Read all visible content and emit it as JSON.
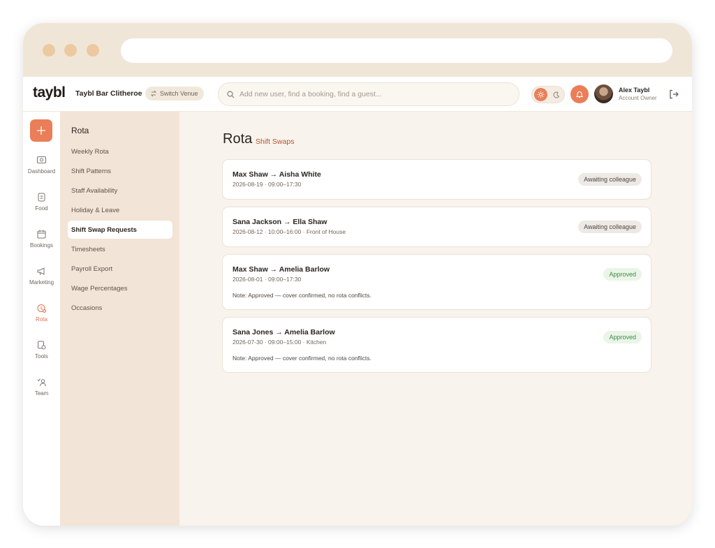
{
  "colors": {
    "accent": "#ea7e58",
    "accent_text": "#b5532f",
    "titlebar": "#f0e6d8",
    "subnav_bg": "#f2e4d6",
    "main_bg": "#f8f3ec",
    "awaiting_badge_bg": "#ede9e4",
    "approved_badge_bg": "#eaf5e8",
    "approved_badge_text": "#3d8a45"
  },
  "header": {
    "logo": "taybl",
    "venue": "Taybl Bar Clitheroe",
    "switch_venue": "Switch Venue",
    "search_placeholder": "Add new user, find a booking, find a guest...",
    "user_name": "Alex Taybl",
    "user_role": "Account Owner",
    "icons": [
      "sun-icon",
      "moon-icon",
      "bell-icon",
      "avatar",
      "logout-icon"
    ]
  },
  "rail": {
    "items": [
      {
        "label": "Dashboard",
        "icon": "dashboard-icon",
        "active": false
      },
      {
        "label": "Food",
        "icon": "food-icon",
        "active": false
      },
      {
        "label": "Bookings",
        "icon": "bookings-icon",
        "active": false
      },
      {
        "label": "Marketing",
        "icon": "megaphone-icon",
        "active": false
      },
      {
        "label": "Rota",
        "icon": "rota-icon",
        "active": true
      },
      {
        "label": "Tools",
        "icon": "tools-icon",
        "active": false
      },
      {
        "label": "Team",
        "icon": "team-icon",
        "active": false
      }
    ]
  },
  "subnav": {
    "title": "Rota",
    "items": [
      {
        "label": "Weekly Rota"
      },
      {
        "label": "Shift Patterns"
      },
      {
        "label": "Staff Availability"
      },
      {
        "label": "Holiday & Leave"
      },
      {
        "label": "Shift Swap Requests",
        "active": true
      },
      {
        "label": "Timesheets"
      },
      {
        "label": "Payroll Export"
      },
      {
        "label": "Wage Percentages"
      },
      {
        "label": "Occasions"
      }
    ]
  },
  "main": {
    "title": "Rota",
    "subtitle": "Shift Swaps",
    "swaps": [
      {
        "title": "Max Shaw → Aisha White",
        "meta": "2026-08-19 · 09:00–17:30",
        "status": "Awaiting colleague",
        "note": ""
      },
      {
        "title": "Sana Jackson → Ella Shaw",
        "meta": "2026-08-12 · 10:00–16:00 · Front of House",
        "status": "Awaiting colleague",
        "note": ""
      },
      {
        "title": "Max Shaw → Amelia Barlow",
        "meta": "2026-08-01 · 09:00–17:30",
        "status": "Approved",
        "note": "Note: Approved — cover confirmed, no rota conflicts."
      },
      {
        "title": "Sana Jones → Amelia Barlow",
        "meta": "2026-07-30 · 09:00–15:00 · Kitchen",
        "status": "Approved",
        "note": "Note: Approved — cover confirmed, no rota conflicts."
      }
    ]
  }
}
